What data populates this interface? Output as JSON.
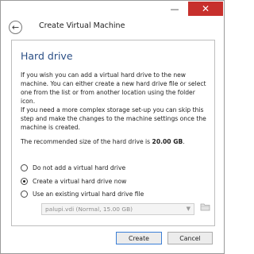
{
  "window": {
    "minimize_glyph": "—",
    "close_glyph": "✕"
  },
  "header": {
    "back_glyph": "←",
    "title": "Create Virtual Machine"
  },
  "section": {
    "title": "Hard drive",
    "paragraph1": "If you wish you can add a virtual hard drive to the new machine. You can either create a new hard drive file or select one from the list or from another location using the folder icon.",
    "paragraph2": "If you need a more complex storage set-up you can skip this step and make the changes to the machine settings once the machine is created.",
    "recommended_prefix": "The recommended size of the hard drive is ",
    "recommended_size": "20.00 GB",
    "recommended_suffix": "."
  },
  "options": {
    "none_label": "Do not add a virtual hard drive",
    "create_label": "Create a virtual hard drive now",
    "existing_label": "Use an existing virtual hard drive file",
    "selected": "create"
  },
  "existing_file": {
    "selected_value": "palupi.vdi (Normal, 15.00 GB)"
  },
  "buttons": {
    "create_label": "Create",
    "cancel_label": "Cancel"
  },
  "icons": {
    "back": "back-arrow-icon",
    "dropdown": "chevron-down-icon",
    "folder": "folder-icon",
    "minimize": "minimize-icon",
    "close": "close-icon"
  },
  "colors": {
    "section_title": "#2b4f86",
    "close_button": "#c7302c",
    "default_button_border": "#3c7fd6"
  }
}
